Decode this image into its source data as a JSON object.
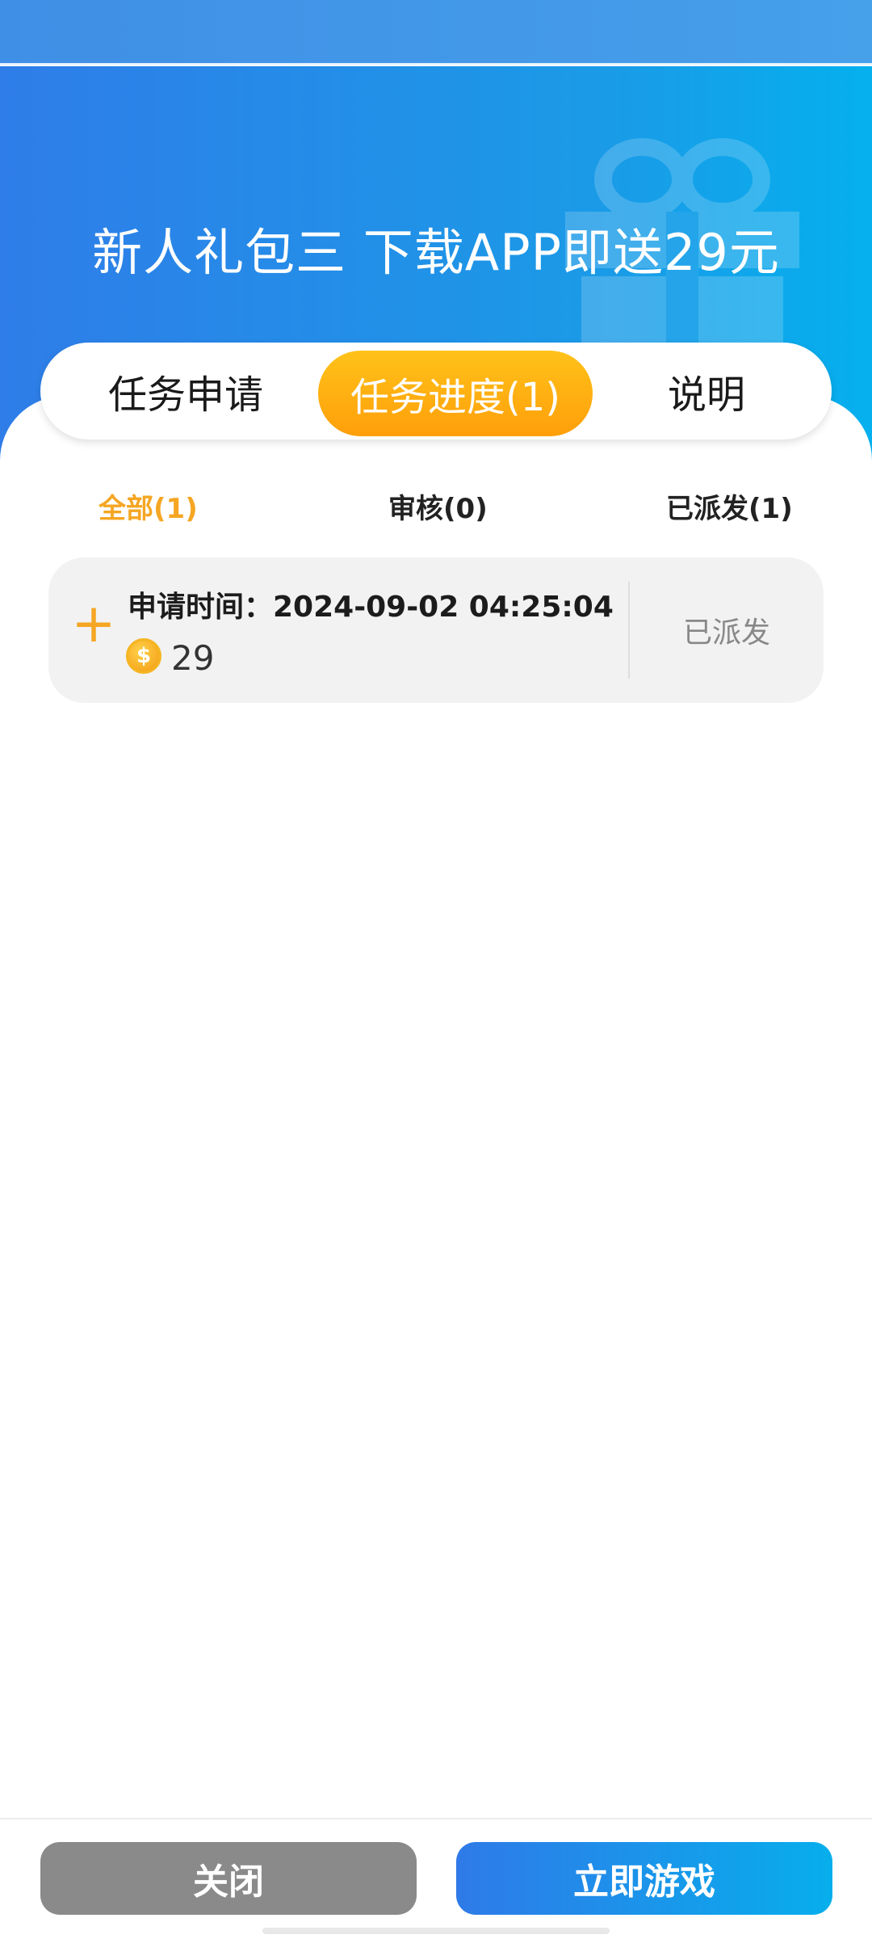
{
  "banner": {
    "title": "新人礼包三 下载APP即送29元",
    "gift_icon": "gift-icon"
  },
  "tabs": {
    "items": [
      {
        "label": "任务申请",
        "active": false
      },
      {
        "label": "任务进度(1)",
        "active": true
      },
      {
        "label": "说明",
        "active": false
      }
    ]
  },
  "filters": {
    "items": [
      {
        "label": "全部(1)",
        "active": true
      },
      {
        "label": "审核(0)",
        "active": false
      },
      {
        "label": "已派发(1)",
        "active": false
      }
    ]
  },
  "records": [
    {
      "time": "申请时间：2024-09-02 04:25:04",
      "amount": "29",
      "coin_symbol": "$",
      "status": "已派发"
    }
  ],
  "actions": {
    "close_label": "关闭",
    "play_label": "立即游戏"
  },
  "colors": {
    "accent_orange": "#f5a623",
    "brand_blue": "#2f7de8",
    "close_gray": "#8a8a8a"
  }
}
